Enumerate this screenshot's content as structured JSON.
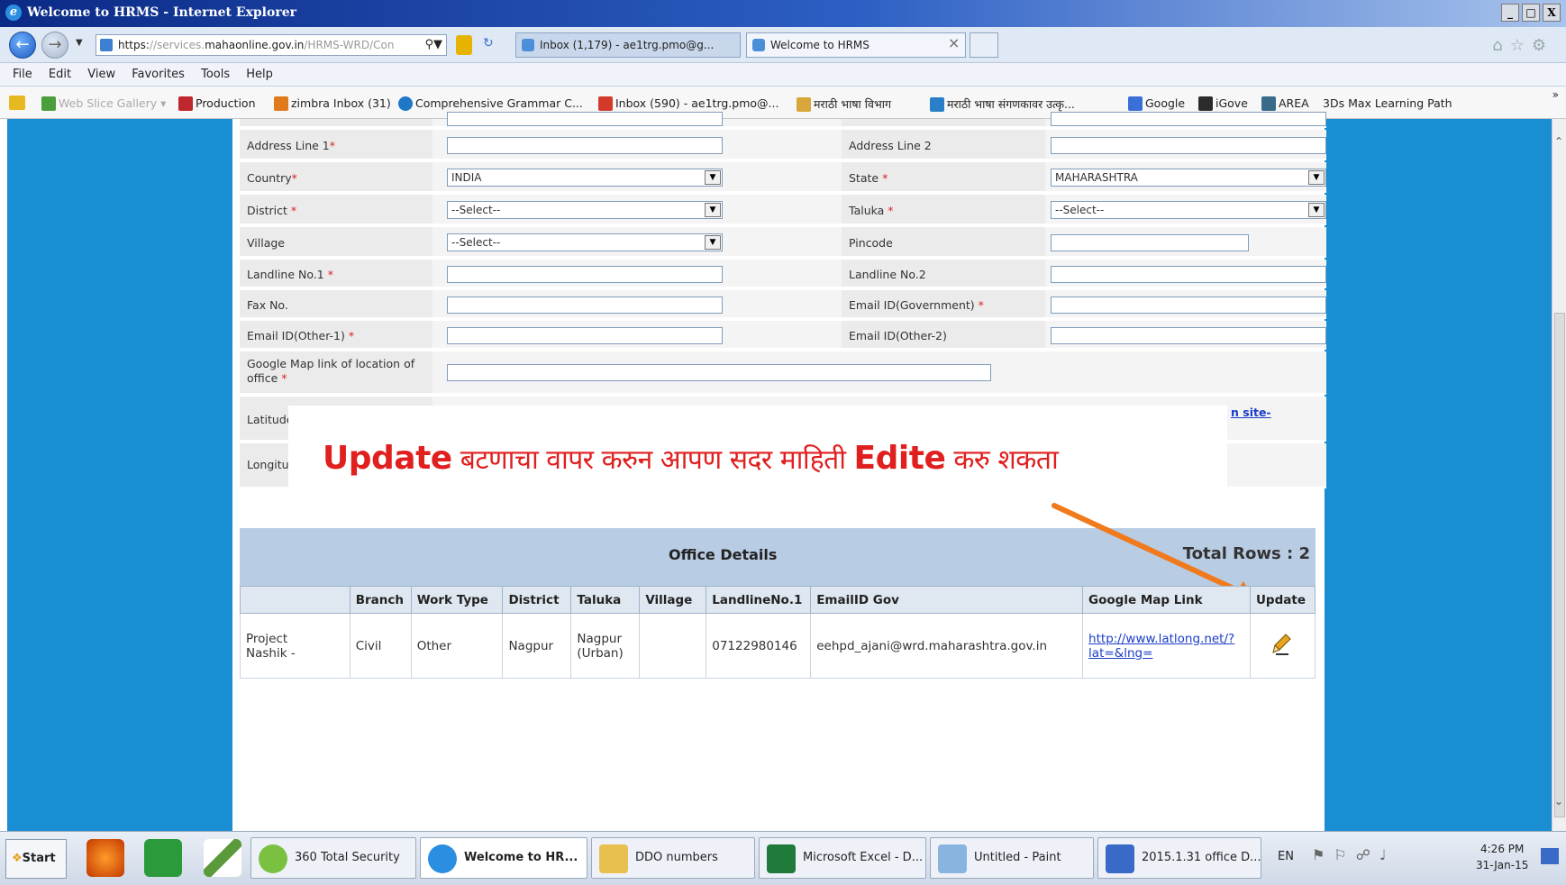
{
  "window": {
    "title": "Welcome to HRMS - Internet Explorer",
    "buttons": [
      "_",
      "□",
      "X"
    ]
  },
  "addressbar": {
    "url_prefix": "https:",
    "url_dim": "//services.",
    "url_main": "mahaonline.gov.in",
    "url_tail": "/HRMS-WRD/Con"
  },
  "tabs": [
    {
      "label": "Inbox (1,179) - ae1trg.pmo@g..."
    },
    {
      "label": "Welcome to HRMS"
    }
  ],
  "menu": [
    "File",
    "Edit",
    "View",
    "Favorites",
    "Tools",
    "Help"
  ],
  "favorites": [
    {
      "label": "Web Slice Gallery",
      "color": "#4a9f3a"
    },
    {
      "label": "Production",
      "color": "#c0262d"
    },
    {
      "label": "zimbra Inbox (31)",
      "color": "#e07a1a"
    },
    {
      "label": "Comprehensive Grammar C...",
      "color": "#1f77c8"
    },
    {
      "label": "Inbox (590) - ae1trg.pmo@...",
      "color": "#d43a2a"
    },
    {
      "label": "मराठी भाषा विभाग",
      "color": "#d8a63a"
    },
    {
      "label": "मराठी भाषा संगणकावर उत्कृ...",
      "color": "#2a7fc8"
    },
    {
      "label": "Google",
      "color": "#3a6fd8"
    },
    {
      "label": "iGove",
      "color": "#2b2b2b"
    },
    {
      "label": "AREA",
      "color": "#3a6a8a"
    },
    {
      "label": "3Ds Max Learning Path",
      "color": "#555"
    }
  ],
  "form": {
    "address_line1": "Address Line 1",
    "address_line2": "Address Line 2",
    "country": "Country",
    "country_value": "INDIA",
    "state": "State",
    "state_value": "MAHARASHTRA",
    "district": "District",
    "district_value": "--Select--",
    "taluka": "Taluka",
    "taluka_value": "--Select--",
    "village": "Village",
    "village_value": "--Select--",
    "pincode": "Pincode",
    "landline1": "Landline No.1",
    "landline2": "Landline No.2",
    "fax": "Fax No.",
    "email_gov": "Email ID(Government)",
    "email_other1": "Email ID(Other-1)",
    "email_other2": "Email ID(Other-2)",
    "gmap_line1": "Google Map link of location of",
    "gmap_line2": "office",
    "latitude": "Latitude",
    "longitude": "Longitude",
    "site_link": "n site-",
    "req_mark": "*"
  },
  "overlay": {
    "word1": "Update",
    "text1": " बटणाचा वापर करुन आपण सदर माहिती ",
    "word2": "Edite",
    "text2": " करु शकता"
  },
  "table": {
    "title": "Office Details",
    "total_rows": "Total Rows : 2",
    "headers": [
      "",
      "Branch",
      "Work Type",
      "District",
      "Taluka",
      "Village",
      "LandlineNo.1",
      "EmailID Gov",
      "Google Map Link",
      "Update"
    ],
    "row": {
      "office_l1": "Project",
      "office_l2": "Nashik -",
      "branch": "Civil",
      "work_type": "Other",
      "district": "Nagpur",
      "taluka_l1": "Nagpur",
      "taluka_l2": "(Urban)",
      "village": "",
      "landline": "07122980146",
      "email": "eehpd_ajani@wrd.maharashtra.gov.in",
      "map_l1": "http://www.latlong.net/?",
      "map_l2": "lat=&lng="
    }
  },
  "taskbar": {
    "start": "Start",
    "items": [
      "360 Total Security",
      "Welcome to HR...",
      "DDO numbers",
      "Microsoft Excel - D...",
      "Untitled - Paint",
      "2015.1.31 office D..."
    ],
    "lang": "EN",
    "time": "4:26 PM",
    "date": "31-Jan-15"
  }
}
